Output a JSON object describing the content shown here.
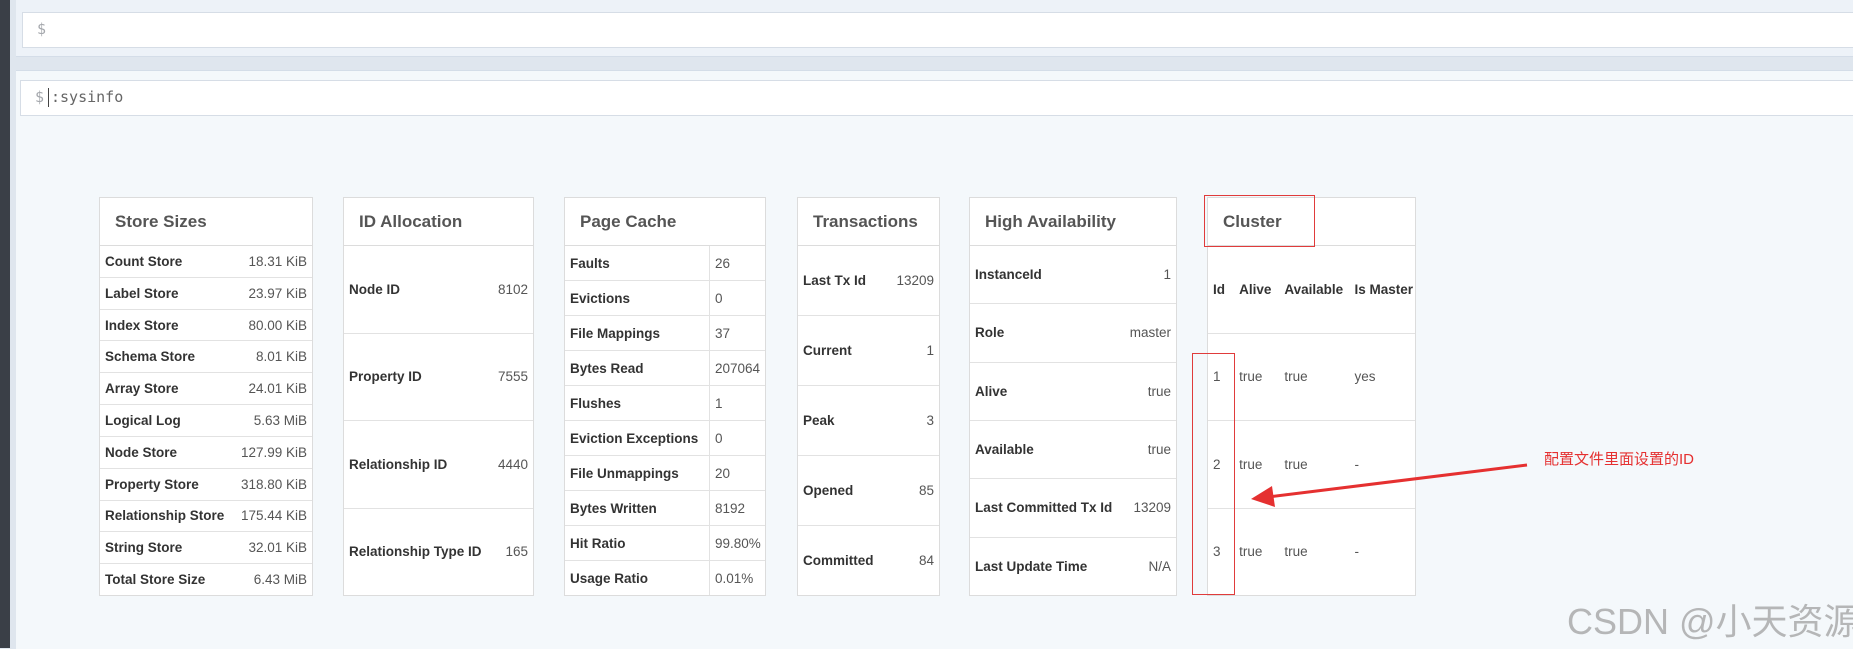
{
  "editor_top": {
    "prompt": "$"
  },
  "editor_main": {
    "prompt": "$",
    "command": ":sysinfo"
  },
  "store_sizes": {
    "title": "Store Sizes",
    "rows": [
      {
        "k": "Count Store",
        "v": "18.31 KiB"
      },
      {
        "k": "Label Store",
        "v": "23.97 KiB"
      },
      {
        "k": "Index Store",
        "v": "80.00 KiB"
      },
      {
        "k": "Schema Store",
        "v": "8.01 KiB"
      },
      {
        "k": "Array Store",
        "v": "24.01 KiB"
      },
      {
        "k": "Logical Log",
        "v": "5.63 MiB"
      },
      {
        "k": "Node Store",
        "v": "127.99 KiB"
      },
      {
        "k": "Property Store",
        "v": "318.80 KiB"
      },
      {
        "k": "Relationship Store",
        "v": "175.44 KiB"
      },
      {
        "k": "String Store",
        "v": "32.01 KiB"
      },
      {
        "k": "Total Store Size",
        "v": "6.43 MiB"
      }
    ]
  },
  "id_allocation": {
    "title": "ID Allocation",
    "rows": [
      {
        "k": "Node ID",
        "v": "8102"
      },
      {
        "k": "Property ID",
        "v": "7555"
      },
      {
        "k": "Relationship ID",
        "v": "4440"
      },
      {
        "k": "Relationship Type ID",
        "v": "165"
      }
    ]
  },
  "page_cache": {
    "title": "Page Cache",
    "rows": [
      {
        "k": "Faults",
        "v": "26"
      },
      {
        "k": "Evictions",
        "v": "0"
      },
      {
        "k": "File Mappings",
        "v": "37"
      },
      {
        "k": "Bytes Read",
        "v": "207064"
      },
      {
        "k": "Flushes",
        "v": "1"
      },
      {
        "k": "Eviction Exceptions",
        "v": "0"
      },
      {
        "k": "File Unmappings",
        "v": "20"
      },
      {
        "k": "Bytes Written",
        "v": "8192"
      },
      {
        "k": "Hit Ratio",
        "v": "99.80%"
      },
      {
        "k": "Usage Ratio",
        "v": "0.01%"
      }
    ]
  },
  "transactions": {
    "title": "Transactions",
    "rows": [
      {
        "k": "Last Tx Id",
        "v": "13209"
      },
      {
        "k": "Current",
        "v": "1"
      },
      {
        "k": "Peak",
        "v": "3"
      },
      {
        "k": "Opened",
        "v": "85"
      },
      {
        "k": "Committed",
        "v": "84"
      }
    ]
  },
  "high_availability": {
    "title": "High Availability",
    "rows": [
      {
        "k": "InstanceId",
        "v": "1"
      },
      {
        "k": "Role",
        "v": "master"
      },
      {
        "k": "Alive",
        "v": "true"
      },
      {
        "k": "Available",
        "v": "true"
      },
      {
        "k": "Last Committed Tx Id",
        "v": "13209"
      },
      {
        "k": "Last Update Time",
        "v": "N/A"
      }
    ]
  },
  "cluster": {
    "title": "Cluster",
    "headers": [
      "Id",
      "Alive",
      "Available",
      "Is Master"
    ],
    "rows": [
      [
        "1",
        "true",
        "true",
        "yes"
      ],
      [
        "2",
        "true",
        "true",
        "-"
      ],
      [
        "3",
        "true",
        "true",
        "-"
      ]
    ]
  },
  "annotation": {
    "text": "配置文件里面设置的ID",
    "color": "#e53030"
  },
  "watermark": "CSDN @小天资源"
}
